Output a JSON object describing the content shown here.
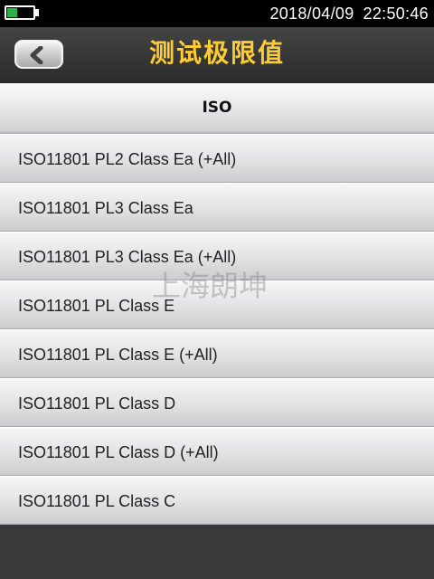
{
  "status_bar": {
    "battery_level": 0.4,
    "battery_color": "#27b54a",
    "date": "2018/04/09",
    "time": "22:50:46"
  },
  "header": {
    "back_icon": "chevron-left-icon",
    "title": "测试极限值",
    "title_color": "#ffcc33"
  },
  "list": {
    "group_label": "ISO",
    "items": [
      "ISO11801 PL2 Class Ea (+All)",
      "ISO11801 PL3 Class Ea",
      "ISO11801 PL3 Class Ea (+All)",
      "ISO11801 PL Class E",
      "ISO11801 PL Class E (+All)",
      "ISO11801 PL Class D",
      "ISO11801 PL Class D (+All)",
      "ISO11801 PL Class C"
    ]
  },
  "watermark": "上海朗坤"
}
